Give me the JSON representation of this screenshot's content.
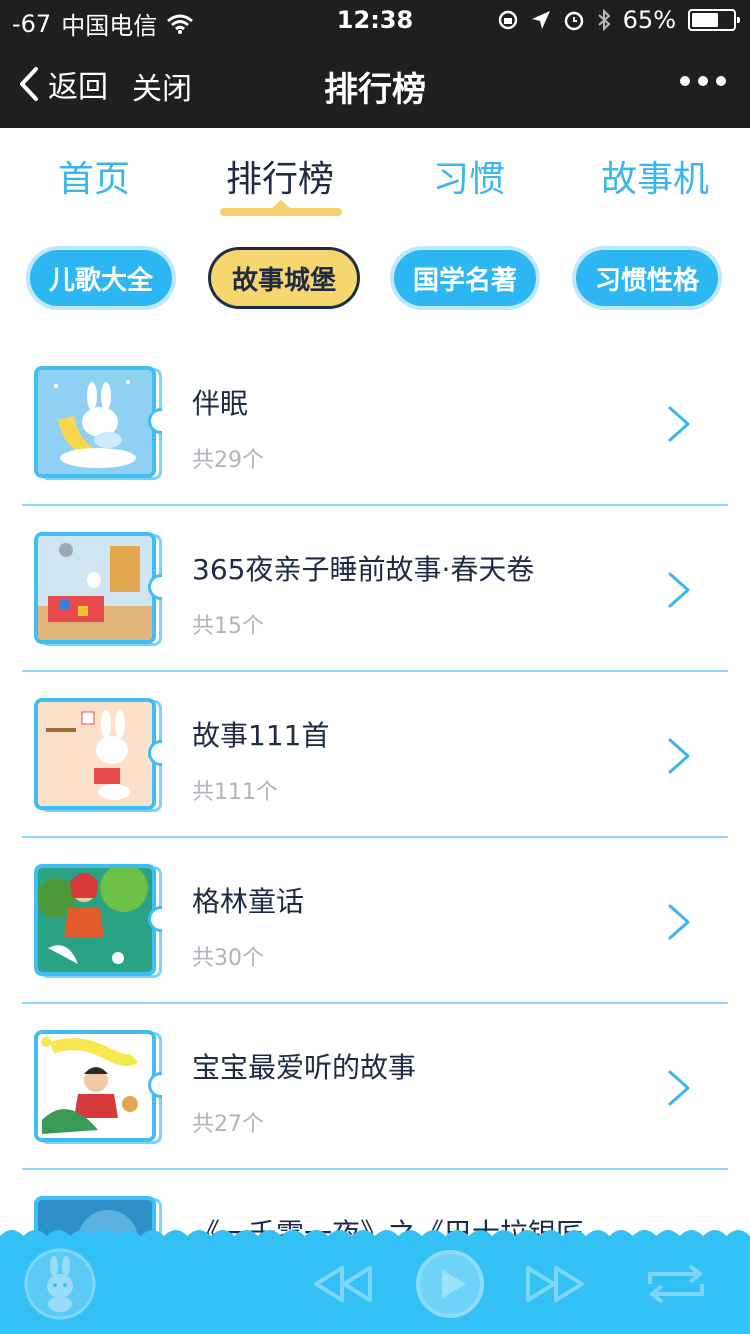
{
  "status_bar": {
    "signal": "-67",
    "carrier": "中国电信",
    "time": "12:38",
    "battery_percent": "65%",
    "battery_level": 0.65,
    "icons": [
      "wifi-icon",
      "rotation-lock-icon",
      "location-icon",
      "alarm-icon",
      "bluetooth-icon",
      "battery-icon"
    ]
  },
  "nav": {
    "back_label": "返回",
    "close_label": "关闭",
    "title": "排行榜",
    "more_icon": "more-dots-icon"
  },
  "tabs": [
    {
      "label": "首页",
      "active": false
    },
    {
      "label": "排行榜",
      "active": true
    },
    {
      "label": "习惯",
      "active": false
    },
    {
      "label": "故事机",
      "active": false
    }
  ],
  "categories": [
    {
      "label": "儿歌大全",
      "active": false
    },
    {
      "label": "故事城堡",
      "active": true
    },
    {
      "label": "国学名著",
      "active": false
    },
    {
      "label": "习惯性格",
      "active": false
    }
  ],
  "list": [
    {
      "title": "伴眠",
      "count": "共29个"
    },
    {
      "title": "365夜亲子睡前故事·春天卷",
      "count": "共15个"
    },
    {
      "title": "故事111首",
      "count": "共111个"
    },
    {
      "title": "格林童话",
      "count": "共30个"
    },
    {
      "title": "宝宝最爱听的故事",
      "count": "共27个"
    },
    {
      "title": "《一千零一夜》之《巴士拉银匠",
      "count": ""
    }
  ],
  "player": {
    "controls": [
      "rabbit-avatar-icon",
      "rewind-icon",
      "play-icon",
      "fast-forward-icon",
      "repeat-icon"
    ]
  },
  "colors": {
    "accent": "#39b6ee",
    "highlight": "#f6d16b",
    "dark": "#1f2a44",
    "player": "#33c1f5"
  }
}
